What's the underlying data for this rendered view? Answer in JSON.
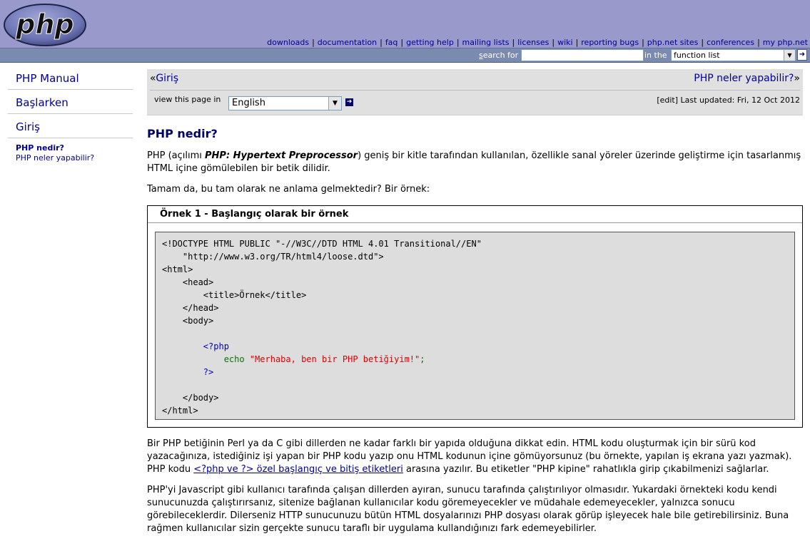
{
  "header": {
    "logo_text": "php",
    "nav": [
      {
        "label": "downloads"
      },
      {
        "label": "documentation"
      },
      {
        "label": "faq"
      },
      {
        "label": "getting help"
      },
      {
        "label": "mailing lists"
      },
      {
        "label": "licenses"
      },
      {
        "label": "wiki"
      },
      {
        "label": "reporting bugs"
      },
      {
        "label": "php.net sites"
      },
      {
        "label": "conferences"
      },
      {
        "label": "my php.net"
      }
    ]
  },
  "search": {
    "label_first": "s",
    "label_rest": "earch for",
    "value": "",
    "in_label": "in the",
    "scope": "function list"
  },
  "sidebar": {
    "items": [
      {
        "label": "PHP Manual"
      },
      {
        "label": "Başlarken"
      },
      {
        "label": "Giriş"
      }
    ],
    "sub": {
      "current": "PHP nedir?",
      "other": "PHP neler yapabilir?"
    }
  },
  "pagenav": {
    "prev_arrow": "«",
    "prev": "Giriş",
    "next": "PHP neler yapabilir?",
    "next_arrow": "»",
    "view_label": "view this page in",
    "language": "English",
    "edit": "[edit]",
    "updated": "Last updated: Fri, 12 Oct 2012"
  },
  "main": {
    "title": "PHP nedir?",
    "p1_a": "PHP (açılımı ",
    "p1_b": "PHP: Hypertext Preprocessor",
    "p1_c": ") geniş bir kitle tarafından kullanılan, özellikle sanal yöreler üzerinde geliştirme için tasarlanmış HTML içine gömülebilen bir betik dilidir.",
    "p2": "Tamam da, bu tam olarak ne anlama gelmektedir? Bir örnek:",
    "example_title": "Örnek 1 - Başlangıç olarak bir örnek",
    "code": {
      "l1": "<!DOCTYPE HTML PUBLIC \"-//W3C//DTD HTML 4.01 Transitional//EN\"",
      "l2": "    \"http://www.w3.org/TR/html4/loose.dtd\">",
      "l3": "<html>",
      "l4": "    <head>",
      "l5": "        <title>Örnek</title>",
      "l6": "    </head>",
      "l7": "    <body>",
      "l9": "        <?php",
      "l10_kw": "echo ",
      "l10_str": "\"Merhaba, ben bir PHP betiğiyim!\"",
      "l10_end": ";",
      "l11": "        ?>",
      "l13": "    </body>",
      "l14": "</html>"
    },
    "p3_a": "Bir PHP betiğinin Perl ya da C gibi dillerden ne kadar farklı bir yapıda olduğuna dikkat edin. HTML kodu oluşturmak için bir sürü kod yazacağınıza, istediğiniz işi yapan bir PHP kodu yazıp onu HTML kodunun içine gömüyorsunuz (bu örnekte, yapılan iş ekrana yazı yazmak). PHP kodu ",
    "p3_link": "<?php ve ?> özel başlangıç ve bitiş etiketleri",
    "p3_b": " arasına yazılır. Bu etiketler \"PHP kipine\" rahatlıkla girip çıkabilmenizi sağlarlar.",
    "p4": "PHP'yi Javascript gibi kullanıcı tarafında çalışan dillerden ayıran, sunucu tarafında çalıştırılıyor olmasıdır. Yukardaki örnekteki kodu kendi sunucunuzda çalıştırırsanız, sitenize bağlanan kullanıcılar kodu göremeyecekler ve müdahale edemeyecekler, yalnızca sonucu görebileceklerdir. Dilerseniz HTTP sunucunuzu bütün HTML dosyalarınızı PHP dosyası olarak görüp işleyecek hale bile getirebilirsiniz. Buna rağmen kullanıcılar sizin gerçekte sunucu taraflı bir uygulama kullandığınızı fark edemeyebilirler."
  }
}
